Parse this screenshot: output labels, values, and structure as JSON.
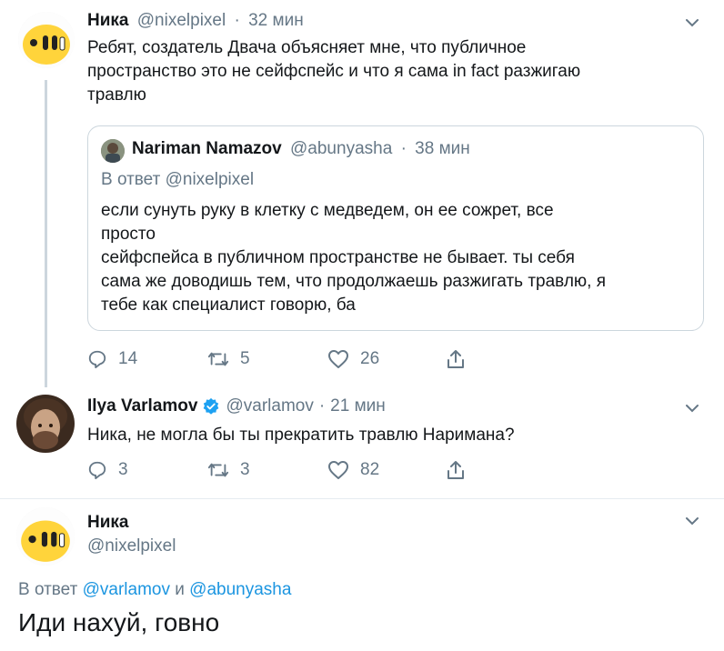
{
  "tweet1": {
    "name": "Ника",
    "handle": "@nixelpixel",
    "sep": "·",
    "time": "32 мин",
    "text_lines": [
      "Ребят, создатель Двача объясняет мне, что публичное",
      "пространство это не сейфспейс и что я сама in fact разжигаю",
      "травлю"
    ],
    "quote": {
      "name": "Nariman Namazov",
      "handle": "@abunyasha",
      "sep": "·",
      "time": "38 мин",
      "reply_prefix": "В ответ",
      "reply_handle": "@nixelpixel",
      "text_lines": [
        "если сунуть руку в клетку с медведем, он ее сожрет, все",
        "просто",
        "сейфспейса в публичном пространстве не бывает. ты себя",
        "сама же доводишь тем, что продолжаешь разжигать травлю, я",
        "тебе как специалист говорю, ба"
      ]
    },
    "replies": "14",
    "retweets": "5",
    "likes": "26"
  },
  "tweet2": {
    "name": "Ilya Varlamov",
    "handle": "@varlamov",
    "sep": "·",
    "time": "21 мин",
    "text": "Ника, не могла бы ты прекратить травлю Наримана?",
    "replies": "3",
    "retweets": "3",
    "likes": "82"
  },
  "tweet3": {
    "name": "Ника",
    "handle": "@nixelpixel",
    "reply_prefix": "В ответ",
    "reply_handle_1": "@varlamov",
    "reply_and": "и",
    "reply_handle_2": "@abunyasha",
    "text": "Иди нахуй, говно"
  },
  "colors": {
    "link": "#1b95e0",
    "muted": "#657786",
    "verified": "#1da1f2",
    "avatar_yellow": "#ffd43b"
  }
}
